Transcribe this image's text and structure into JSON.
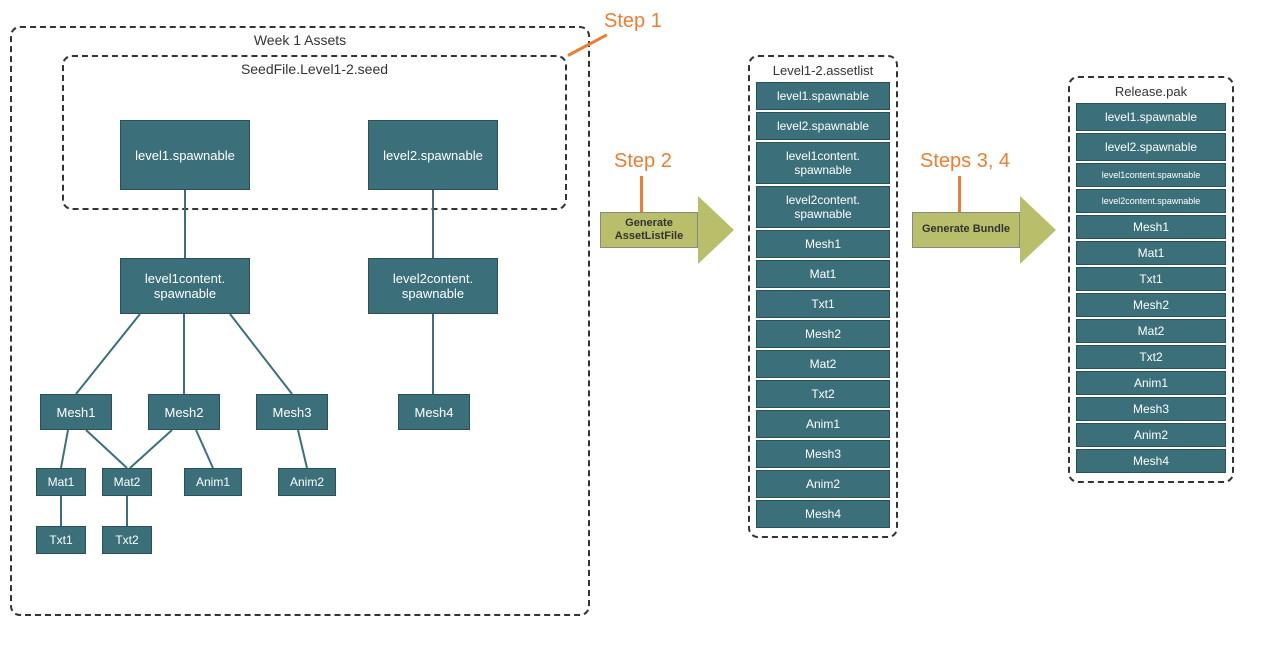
{
  "week1": {
    "title": "Week 1 Assets",
    "seedfile_title": "SeedFile.Level1-2.seed",
    "nodes": {
      "level1": "level1.spawnable",
      "level2": "level2.spawnable",
      "level1content": "level1content.\nspawnable",
      "level2content": "level2content.\nspawnable",
      "mesh1": "Mesh1",
      "mesh2": "Mesh2",
      "mesh3": "Mesh3",
      "mesh4": "Mesh4",
      "mat1": "Mat1",
      "mat2": "Mat2",
      "anim1": "Anim1",
      "anim2": "Anim2",
      "txt1": "Txt1",
      "txt2": "Txt2"
    }
  },
  "steps": {
    "step1": "Step 1",
    "step2": "Step 2",
    "step34": "Steps 3, 4"
  },
  "arrows": {
    "generate_assetlist": "Generate\nAssetListFile",
    "generate_bundle": "Generate Bundle"
  },
  "assetlist": {
    "title": "Level1-2.assetlist",
    "items": [
      "level1.spawnable",
      "level2.spawnable",
      "level1content.\nspawnable",
      "level2content.\nspawnable",
      "Mesh1",
      "Mat1",
      "Txt1",
      "Mesh2",
      "Mat2",
      "Txt2",
      "Anim1",
      "Mesh3",
      "Anim2",
      "Mesh4"
    ]
  },
  "release": {
    "title": "Release.pak",
    "items": [
      "level1.spawnable",
      "level2.spawnable",
      "level1content.spawnable",
      "level2content.spawnable",
      "Mesh1",
      "Mat1",
      "Txt1",
      "Mesh2",
      "Mat2",
      "Txt2",
      "Anim1",
      "Mesh3",
      "Anim2",
      "Mesh4"
    ]
  }
}
